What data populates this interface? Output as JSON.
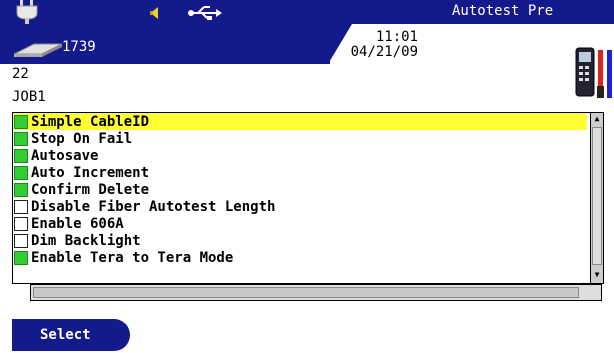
{
  "header": {
    "title": "Autotest Pre",
    "count": "1739",
    "time": "11:01",
    "date": "04/21/09",
    "line1": "22",
    "job": "JOB1",
    "icons": [
      "plug-icon",
      "speaker-icon",
      "usb-icon",
      "drive-icon",
      "cable-tester-icon"
    ]
  },
  "list": {
    "items": [
      {
        "label": "Simple CableID",
        "checked": true,
        "selected": true
      },
      {
        "label": "Stop On Fail",
        "checked": true,
        "selected": false
      },
      {
        "label": "Autosave",
        "checked": true,
        "selected": false
      },
      {
        "label": "Auto Increment",
        "checked": true,
        "selected": false
      },
      {
        "label": "Confirm Delete",
        "checked": true,
        "selected": false
      },
      {
        "label": "Disable Fiber Autotest Length",
        "checked": false,
        "selected": false
      },
      {
        "label": "Enable 606A",
        "checked": false,
        "selected": false
      },
      {
        "label": "Dim Backlight",
        "checked": false,
        "selected": false
      },
      {
        "label": "Enable Tera to Tera Mode",
        "checked": true,
        "selected": false
      }
    ]
  },
  "softkeys": {
    "left_label": "Select"
  },
  "colors": {
    "header_bg": "#141a8c",
    "selection": "#ffff33",
    "checked": "#33cc33"
  }
}
